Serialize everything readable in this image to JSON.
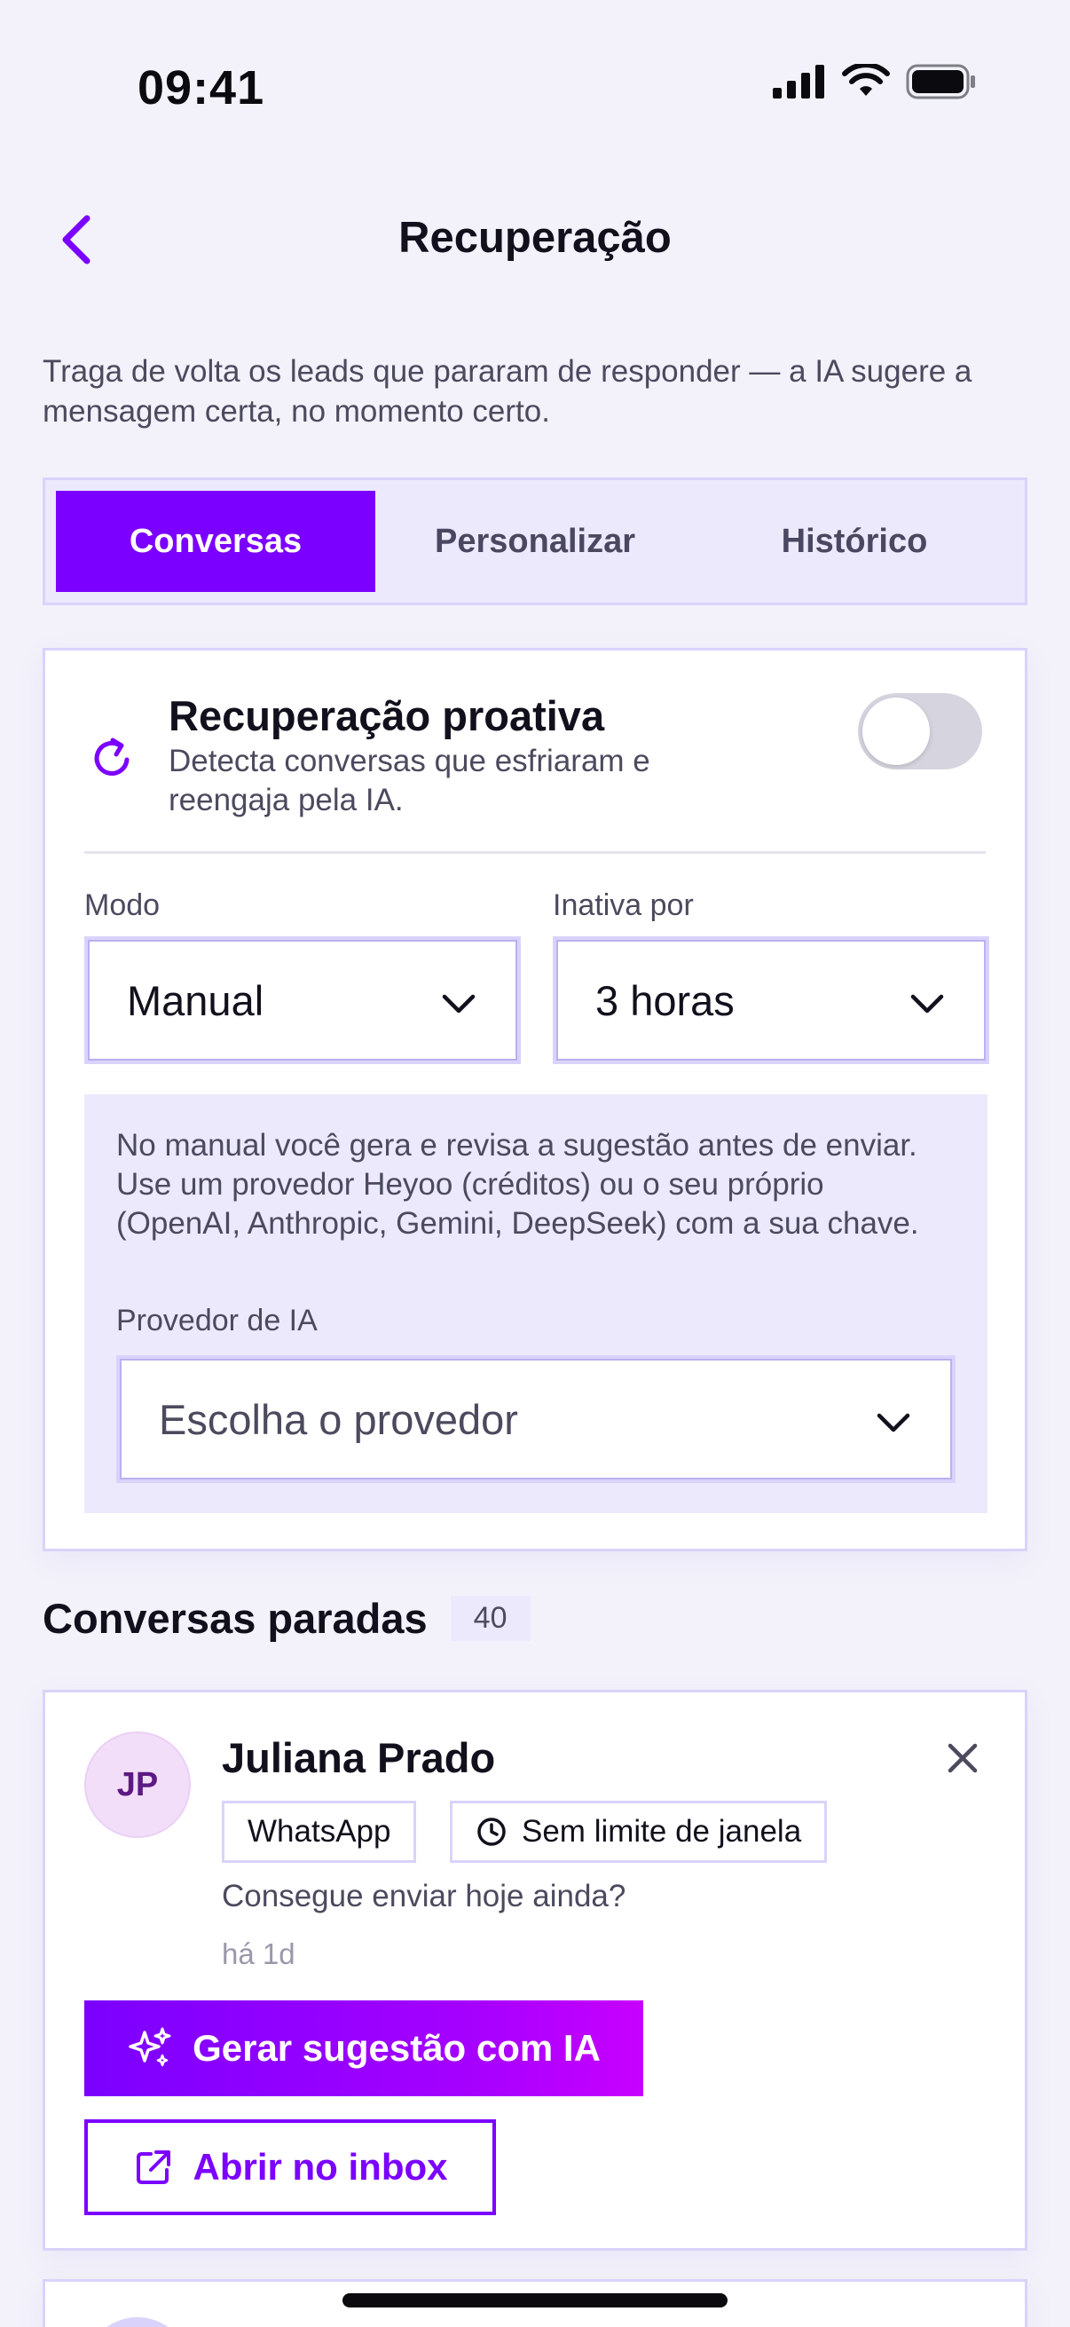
{
  "status": {
    "time": "09:41"
  },
  "nav": {
    "title": "Recuperação"
  },
  "subtitle": "Traga de volta os leads que pararam de responder — a IA sugere a mensagem certa, no momento certo.",
  "tabs": [
    {
      "label": "Conversas",
      "active": true
    },
    {
      "label": "Personalizar",
      "active": false
    },
    {
      "label": "Histórico",
      "active": false
    }
  ],
  "proactive": {
    "title": "Recuperação proativa",
    "description": "Detecta conversas que esfriaram e reengaja pela IA.",
    "enabled": false,
    "mode_label": "Modo",
    "mode_value": "Manual",
    "inactive_label": "Inativa por",
    "inactive_value": "3 horas",
    "info_text": "No manual você gera e revisa a sugestão antes de enviar. Use um provedor Heyoo (créditos) ou o seu próprio (OpenAI, Anthropic, Gemini, DeepSeek) com a sua chave.",
    "provider_label": "Provedor de IA",
    "provider_placeholder": "Escolha o provedor"
  },
  "stalled": {
    "title": "Conversas paradas",
    "count": "40",
    "items": [
      {
        "initials": "JP",
        "name": "Juliana Prado",
        "channel": "WhatsApp",
        "window": "Sem limite de janela",
        "message": "Consegue enviar hoje ainda?",
        "time": "há 1d",
        "ai_button": "Gerar sugestão com IA",
        "inbox_button": "Abrir no inbox"
      }
    ]
  },
  "colors": {
    "accent": "#7b00ff",
    "accent_end": "#c800ff",
    "tab_bg": "#ece9fd",
    "border": "#d9d3fb"
  }
}
